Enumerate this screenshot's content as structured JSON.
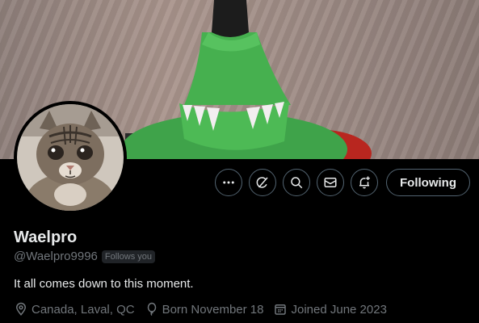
{
  "profile": {
    "display_name": "Waelpro",
    "handle": "@Waelpro9996",
    "follows_you_badge": "Follows you",
    "bio": "It all comes down to this moment.",
    "location": "Canada, Laval, QC",
    "birthday": "Born November 18",
    "joined": "Joined June 2023"
  },
  "actions": {
    "more_icon": "more-horizontal-icon",
    "grok_icon": "grok-icon",
    "search_icon": "search-icon",
    "message_icon": "envelope-icon",
    "notify_icon": "bell-plus-icon",
    "following_label": "Following"
  },
  "colors": {
    "background": "#000000",
    "primary_text": "#e7e9ea",
    "secondary_text": "#71767b",
    "border": "#536471",
    "badge_bg": "#202327"
  }
}
